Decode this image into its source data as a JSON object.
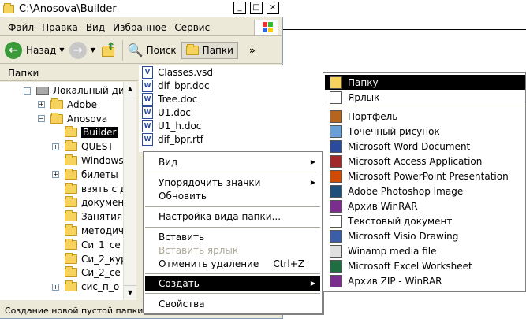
{
  "window": {
    "title": "C:\\Anosova\\Builder"
  },
  "title_buttons": {
    "min": "_",
    "max": "□",
    "close": "×"
  },
  "menu": [
    "Файл",
    "Правка",
    "Вид",
    "Избранное",
    "Сервис"
  ],
  "toolbar": {
    "back": "Назад",
    "search": "Поиск",
    "folders": "Папки",
    "more": "»"
  },
  "pane_header": {
    "label": "Папки",
    "close": "×"
  },
  "tree": [
    {
      "label": "Локальный дис",
      "expander": "−"
    },
    {
      "label": "Adobe",
      "expander": "+"
    },
    {
      "label": "Anosova",
      "expander": "−"
    },
    {
      "label": "Builder",
      "expander": "",
      "selected": true
    },
    {
      "label": "QUEST",
      "expander": "+"
    },
    {
      "label": "Windows",
      "expander": ""
    },
    {
      "label": "билеты",
      "expander": "+"
    },
    {
      "label": "взять с д",
      "expander": ""
    },
    {
      "label": "докумен",
      "expander": ""
    },
    {
      "label": "Занятия",
      "expander": ""
    },
    {
      "label": "методич",
      "expander": ""
    },
    {
      "label": "Си_1_се",
      "expander": ""
    },
    {
      "label": "Си_2_кур",
      "expander": ""
    },
    {
      "label": "Си_2_се",
      "expander": ""
    },
    {
      "label": "сис_п_о",
      "expander": "+"
    }
  ],
  "files": [
    "Classes.vsd",
    "dif_bpr.doc",
    "Tree.doc",
    "U1.doc",
    "U1_h.doc",
    "dif_bpr.rtf"
  ],
  "status": {
    "text": "Создание новой пустой папки."
  },
  "context_menu": {
    "view": "Вид",
    "arrange": "Упорядочить значки",
    "refresh": "Обновить",
    "customize": "Настройка вида папки...",
    "paste": "Вставить",
    "paste_shortcut": "Вставить ярлык",
    "undo": "Отменить удаление",
    "undo_accel": "Ctrl+Z",
    "new": "Создать",
    "properties": "Свойства"
  },
  "submenu": [
    {
      "label": "Папку",
      "icon": "folder-icon",
      "color": "#f5d35c",
      "highlighted": true
    },
    {
      "label": "Ярлык",
      "icon": "shortcut-icon",
      "color": "#ffffff"
    },
    {
      "label": "Портфель",
      "icon": "briefcase-icon",
      "color": "#b5651d"
    },
    {
      "label": "Точечный рисунок",
      "icon": "bitmap-icon",
      "color": "#6aa0d8"
    },
    {
      "label": "Microsoft Word Document",
      "icon": "word-icon",
      "color": "#2a4b9b"
    },
    {
      "label": "Microsoft Access Application",
      "icon": "access-icon",
      "color": "#a0282a"
    },
    {
      "label": "Microsoft PowerPoint Presentation",
      "icon": "powerpoint-icon",
      "color": "#d04a02"
    },
    {
      "label": "Adobe Photoshop Image",
      "icon": "photoshop-icon",
      "color": "#1c4f7a"
    },
    {
      "label": "Архив WinRAR",
      "icon": "winrar-icon",
      "color": "#7b2e8e"
    },
    {
      "label": "Текстовый документ",
      "icon": "text-icon",
      "color": "#ffffff"
    },
    {
      "label": "Microsoft Visio Drawing",
      "icon": "visio-icon",
      "color": "#3a5fa8"
    },
    {
      "label": "Winamp media file",
      "icon": "winamp-icon",
      "color": "#e0e0e0"
    },
    {
      "label": "Microsoft Excel Worksheet",
      "icon": "excel-icon",
      "color": "#1d6f42"
    },
    {
      "label": "Архив ZIP - WinRAR",
      "icon": "zip-icon",
      "color": "#7b2e8e"
    }
  ]
}
